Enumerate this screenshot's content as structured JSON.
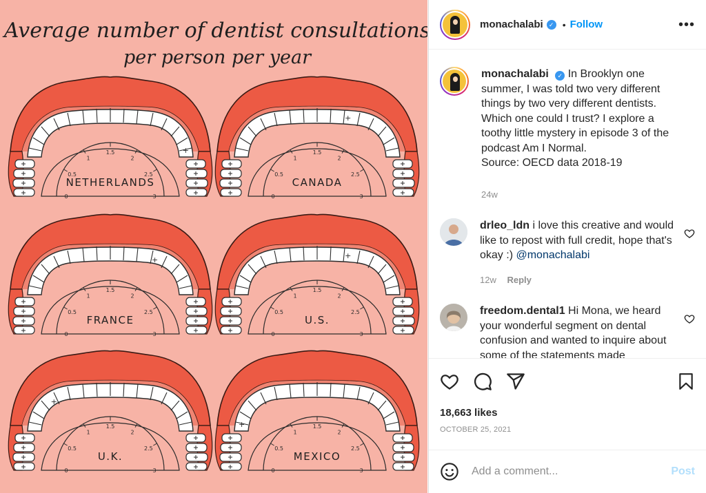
{
  "illustration": {
    "title_line1": "Average number of dentist consultations",
    "title_line2": "per person per year",
    "scale_labels": [
      "0",
      "0.5",
      "1",
      "1.5",
      "2",
      "2.5",
      "3"
    ],
    "tooth_mark": "+",
    "countries": [
      {
        "name": "NETHERLANDS",
        "consultations": 2.9
      },
      {
        "name": "CANADA",
        "consultations": 1.9
      },
      {
        "name": "FRANCE",
        "consultations": 2.1
      },
      {
        "name": "U.S.",
        "consultations": 1.9
      },
      {
        "name": "U.K.",
        "consultations": 0.7
      },
      {
        "name": "MEXICO",
        "consultations": 0.1
      }
    ],
    "colors": {
      "background": "#f7b3a6",
      "lips": "#ec5a44",
      "gum": "#f08472",
      "tooth": "#ffffff",
      "ink": "#2b2b2b"
    }
  },
  "header": {
    "username": "monachalabi",
    "verified_icon": "✓",
    "separator": "•",
    "follow_label": "Follow",
    "more_label": "•••"
  },
  "caption": {
    "username": "monachalabi",
    "text": "In Brooklyn one summer, I was told two very different things by two very different dentists. Which one could I trust? I explore a toothy little mystery in episode 3 of the podcast Am I Normal.",
    "source": "Source: OECD data 2018-19",
    "time": "24w"
  },
  "comments": [
    {
      "username": "drleo_ldn",
      "text": "i love this creative and would like to repost with full credit, hope that's okay :)",
      "mention": "@monachalabi",
      "time": "12w",
      "reply_label": "Reply"
    },
    {
      "username": "freedom.dental1",
      "text": "Hi Mona, we heard your wonderful segment on dental confusion and wanted to inquire about some of the statements made"
    }
  ],
  "actions": {
    "icons": [
      "heart-icon",
      "comment-icon",
      "share-icon",
      "bookmark-icon"
    ],
    "likes": "18,663 likes",
    "date": "OCTOBER 25, 2021"
  },
  "composer": {
    "placeholder": "Add a comment...",
    "post_label": "Post"
  },
  "colors": {
    "accent": "#0095f6",
    "verified": "#3897f0",
    "muted": "#8e8e8e",
    "link": "#00376b"
  }
}
